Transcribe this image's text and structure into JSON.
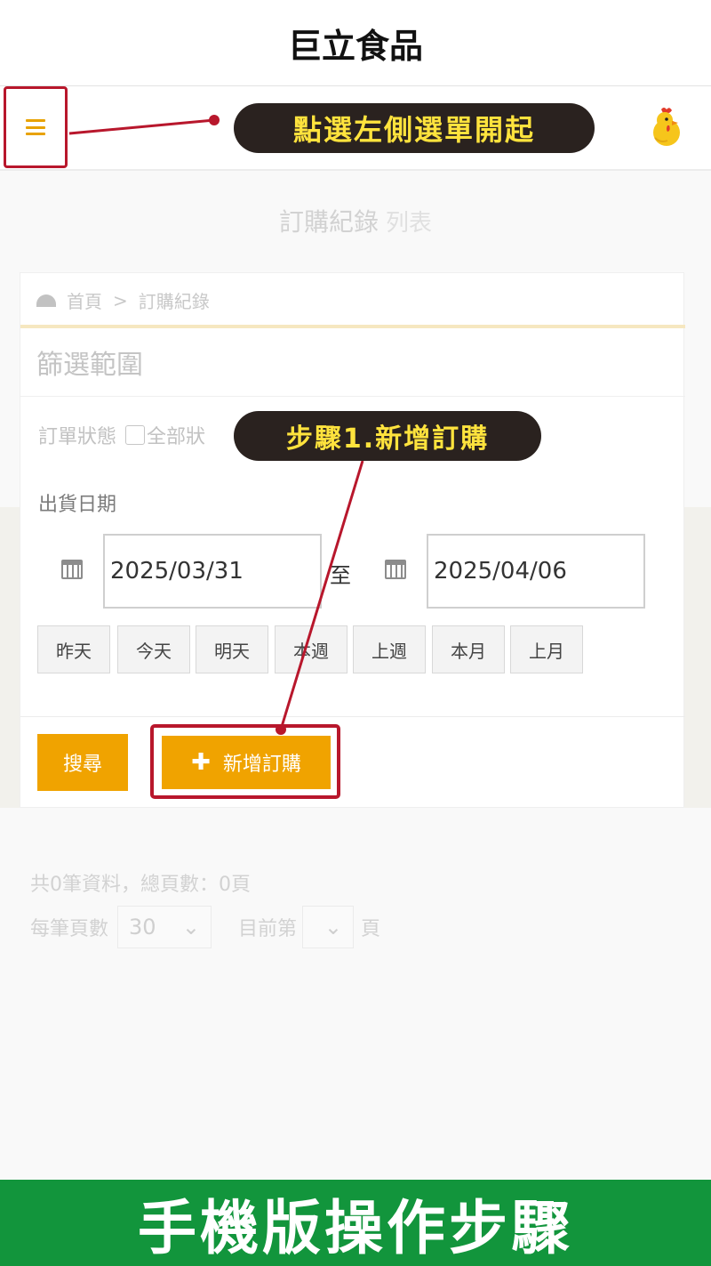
{
  "app": {
    "title": "巨立食品"
  },
  "header": {
    "menu_icon": "hamburger-icon",
    "avatar_icon": "chicken-icon"
  },
  "page": {
    "title": "訂購紀錄",
    "subtitle": "列表"
  },
  "breadcrumb": {
    "home": "首頁",
    "separator": ">",
    "current": "訂購紀錄"
  },
  "filter": {
    "title": "篩選範圍",
    "status_label": "訂單狀態",
    "status_checkbox_label": "全部狀",
    "date_label": "出貨日期",
    "start_date": "2025/03/31",
    "to_label": "至",
    "end_date": "2025/04/06",
    "quick_ranges": [
      "昨天",
      "今天",
      "明天",
      "本週",
      "上週",
      "本月",
      "上月"
    ],
    "search_label": "搜尋",
    "add_label": "新增訂購"
  },
  "results": {
    "count_text": "共0筆資料，總頁數：0頁",
    "per_page_label": "每筆頁數",
    "per_page_value": "30",
    "current_page_prefix": "目前第",
    "current_page_value": "",
    "current_page_suffix": "頁"
  },
  "annotations": {
    "menu_hint": "點選左側選單開起",
    "step1": "步驟1.新增訂購",
    "banner": "手機版操作步驟"
  },
  "colors": {
    "accent": "#f0a300",
    "highlight": "#b8172c",
    "banner": "#12953c",
    "callout_bg": "#2a221f",
    "callout_text": "#ffe33d"
  }
}
